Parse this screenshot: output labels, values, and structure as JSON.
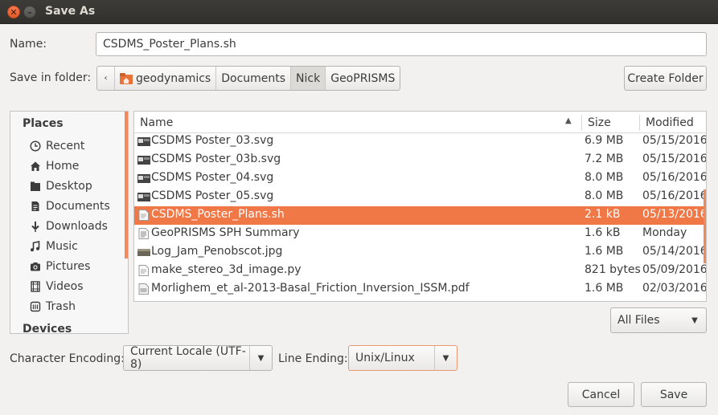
{
  "window": {
    "title": "Save As"
  },
  "name_row": {
    "label": "Name:",
    "value": "CSDMS_Poster_Plans.sh"
  },
  "folder_row": {
    "label": "Save in folder:",
    "crumbs": [
      "geodynamics",
      "Documents",
      "Nick",
      "GeoPRISMS"
    ],
    "create_folder": "Create Folder"
  },
  "places": {
    "heading": "Places",
    "items": [
      "Recent",
      "Home",
      "Desktop",
      "Documents",
      "Downloads",
      "Music",
      "Pictures",
      "Videos",
      "Trash"
    ],
    "devices_heading": "Devices"
  },
  "columns": {
    "name": "Name",
    "size": "Size",
    "modified": "Modified"
  },
  "files": [
    {
      "name": "CSDMS Poster_03.svg",
      "size": "6.9 MB",
      "modified": "05/15/2016",
      "icon": "image-thumb-icon"
    },
    {
      "name": "CSDMS Poster_03b.svg",
      "size": "7.2 MB",
      "modified": "05/15/2016",
      "icon": "image-thumb-icon"
    },
    {
      "name": "CSDMS Poster_04.svg",
      "size": "8.0 MB",
      "modified": "05/16/2016",
      "icon": "image-thumb-icon"
    },
    {
      "name": "CSDMS Poster_05.svg",
      "size": "8.0 MB",
      "modified": "05/16/2016",
      "icon": "image-thumb-icon"
    },
    {
      "name": "CSDMS_Poster_Plans.sh",
      "size": "2.1 kB",
      "modified": "05/13/2016",
      "icon": "script-file-icon",
      "selected": true
    },
    {
      "name": "GeoPRISMS SPH Summary",
      "size": "1.6 kB",
      "modified": "Monday",
      "icon": "document-file-icon"
    },
    {
      "name": "Log_Jam_Penobscot.jpg",
      "size": "1.6 MB",
      "modified": "05/14/2016",
      "icon": "photo-thumb-icon"
    },
    {
      "name": "make_stereo_3d_image.py",
      "size": "821 bytes",
      "modified": "05/09/2016",
      "icon": "script-file-icon"
    },
    {
      "name": "Morlighem_et_al-2013-Basal_Friction_Inversion_ISSM.pdf",
      "size": "1.6 MB",
      "modified": "02/03/2016",
      "icon": "pdf-file-icon"
    }
  ],
  "filter": {
    "value": "All Files"
  },
  "encoding": {
    "label": "Character Encoding:",
    "value": "Current Locale (UTF-8)"
  },
  "line_ending": {
    "label": "Line Ending:",
    "value": "Unix/Linux"
  },
  "buttons": {
    "cancel": "Cancel",
    "save": "Save"
  },
  "colors": {
    "accent": "#f07746",
    "titlebar": "#3d3c38",
    "close_button": "#f47a4e"
  }
}
